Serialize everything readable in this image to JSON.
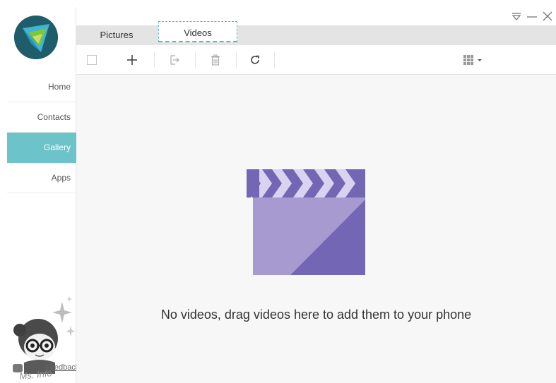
{
  "tabs": {
    "pictures": "Pictures",
    "videos": "Videos"
  },
  "nav": {
    "home": "Home",
    "contacts": "Contacts",
    "gallery": "Gallery",
    "apps": "Apps"
  },
  "sidebar": {
    "feedback": "Feedback"
  },
  "main": {
    "empty_message": "No videos, drag videos here to add them to your phone"
  },
  "watermark": "Ms. Info",
  "colors": {
    "accent": "#6cc3ca",
    "clapper_dark": "#7367b5",
    "clapper_light": "#a79ad0",
    "logo_bg": "#1f5d6b"
  },
  "icons": [
    "logo-icon",
    "select-all-checkbox",
    "add-icon",
    "export-icon",
    "delete-icon",
    "refresh-icon",
    "view-grid-icon",
    "menu-icon",
    "minimize-icon",
    "close-icon",
    "clapperboard-icon"
  ]
}
